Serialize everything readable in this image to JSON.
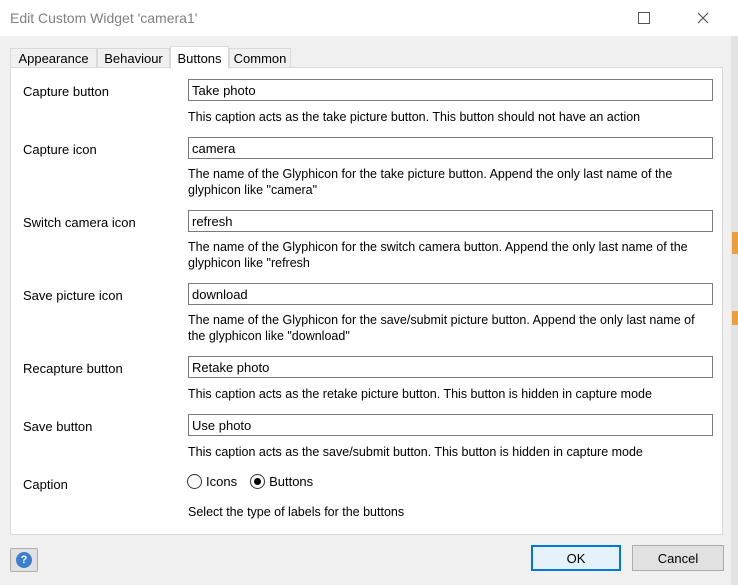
{
  "window": {
    "title": "Edit Custom Widget 'camera1'"
  },
  "tabs": [
    "Appearance",
    "Behaviour",
    "Buttons",
    "Common"
  ],
  "fields": [
    {
      "label": "Capture button",
      "value": "Take photo",
      "description": "This caption acts as the take picture button. This button should not have an action"
    },
    {
      "label": "Capture icon",
      "value": "camera",
      "description": "The name of the Glyphicon for the take picture button. Append the only last name of the glyphicon like \"camera\""
    },
    {
      "label": "Switch camera icon",
      "value": "refresh",
      "description": "The name of the Glyphicon for the switch camera button. Append the only last name of the glyphicon like \"refresh"
    },
    {
      "label": "Save picture icon",
      "value": "download",
      "description": "The name of the Glyphicon for the save/submit picture button. Append the only last name of the glyphicon like \"download\""
    },
    {
      "label": "Recapture button",
      "value": "Retake photo",
      "description": "This caption acts as the retake picture button. This button is hidden in capture mode"
    },
    {
      "label": "Save button",
      "value": "Use photo",
      "description": "This caption acts as the save/submit button. This button is hidden in capture mode"
    }
  ],
  "caption": {
    "label": "Caption",
    "options": [
      "Icons",
      "Buttons"
    ],
    "selected": "Buttons",
    "description": "Select the type of labels for the buttons"
  },
  "footer": {
    "ok_label": "OK",
    "cancel_label": "Cancel"
  }
}
